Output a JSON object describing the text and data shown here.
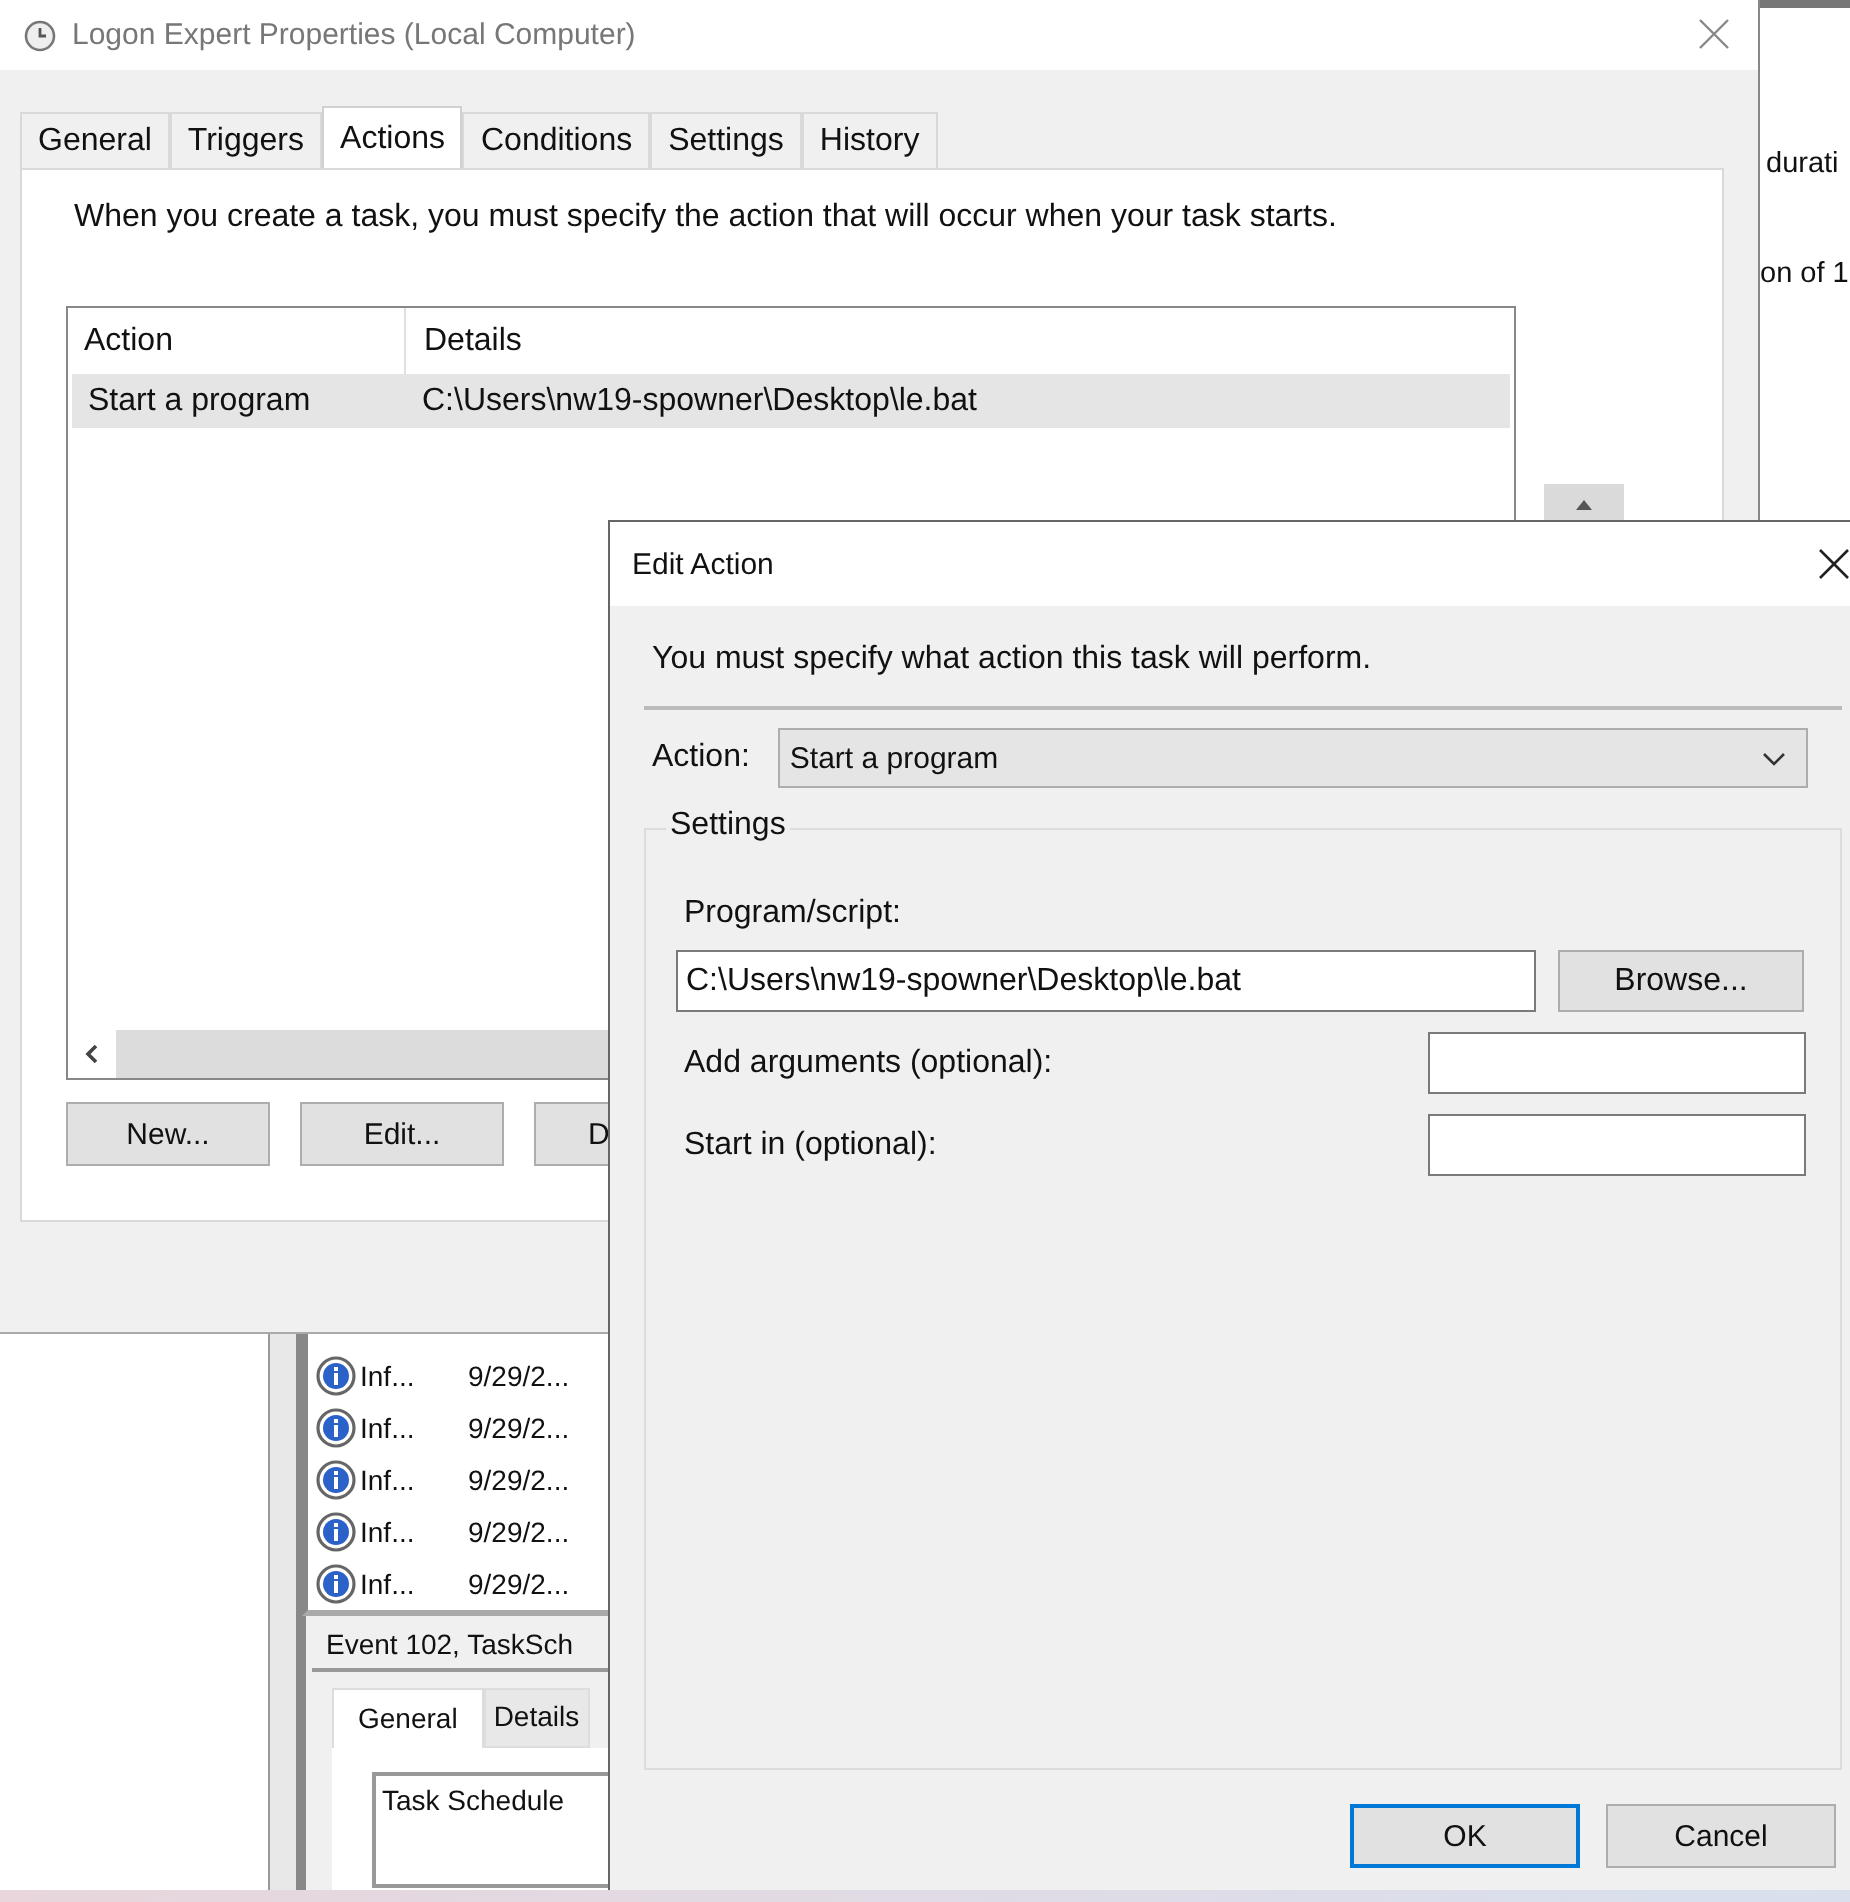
{
  "background_window": {
    "texts": [
      "durati",
      "on of 1"
    ]
  },
  "event_viewer": {
    "rows": [
      {
        "column_1": "Inf...",
        "column_2": "9/29/2..."
      },
      {
        "column_1": "Inf...",
        "column_2": "9/29/2..."
      },
      {
        "column_1": "Inf...",
        "column_2": "9/29/2..."
      },
      {
        "column_1": "Inf...",
        "column_2": "9/29/2..."
      },
      {
        "column_1": "Inf...",
        "column_2": "9/29/2..."
      }
    ],
    "details_title": "Event 102, TaskSch",
    "tabs": [
      {
        "label": "General",
        "selected": true
      },
      {
        "label": "Details",
        "selected": false
      }
    ],
    "description": "Task Schedule"
  },
  "properties_window": {
    "title": "Logon Expert Properties (Local Computer)",
    "tabs": [
      {
        "label": "General",
        "selected": false
      },
      {
        "label": "Triggers",
        "selected": false
      },
      {
        "label": "Actions",
        "selected": true
      },
      {
        "label": "Conditions",
        "selected": false
      },
      {
        "label": "Settings",
        "selected": false
      },
      {
        "label": "History",
        "selected": false
      }
    ],
    "instruction": "When you create a task, you must specify the action that will occur when your task starts.",
    "table": {
      "columns": [
        "Action",
        "Details"
      ],
      "rows": [
        {
          "cells": [
            "Start a program",
            "C:\\Users\\nw19-spowner\\Desktop\\le.bat"
          ],
          "selected": true
        }
      ]
    },
    "buttons": [
      "New...",
      "Edit...",
      "D"
    ]
  },
  "edit_action": {
    "title": "Edit Action",
    "instruction": "You must specify what action this task will perform.",
    "action_label": "Action:",
    "action_value": "Start a program",
    "group_title": "Settings",
    "program_label": "Program/script:",
    "program_value": "C:\\Users\\nw19-spowner\\Desktop\\le.bat",
    "browse_button": "Browse...",
    "arguments_label": "Add arguments (optional):",
    "start_in_label": "Start in (optional):",
    "buttons": [
      {
        "label": "OK",
        "default": true
      },
      {
        "label": "Cancel",
        "default": false
      }
    ]
  }
}
